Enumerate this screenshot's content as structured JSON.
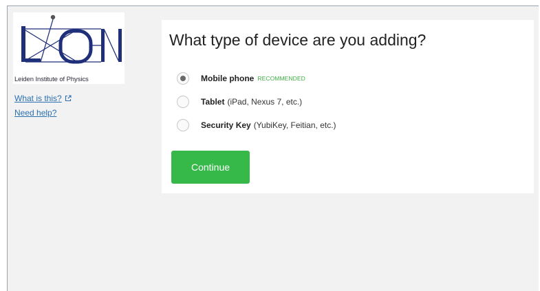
{
  "sidebar": {
    "logo_caption": "Leiden Institute of Physics",
    "logo_icon": "lion-logo-icon",
    "links": {
      "what_is_this": "What is this?",
      "need_help": "Need help?"
    },
    "external_link_icon": "external-link-icon"
  },
  "panel": {
    "title": "What type of device are you adding?",
    "options": [
      {
        "name": "Mobile phone",
        "detail": "",
        "badge": "RECOMMENDED",
        "selected": true
      },
      {
        "name": "Tablet",
        "detail": "(iPad, Nexus 7, etc.)",
        "badge": "",
        "selected": false
      },
      {
        "name": "Security Key",
        "detail": "(YubiKey, Feitian, etc.)",
        "badge": "",
        "selected": false
      }
    ],
    "continue_label": "Continue"
  },
  "colors": {
    "accent_green": "#37b94a",
    "badge_green": "#3cb043",
    "link_blue": "#2a6fb0",
    "logo_navy": "#1f2f7a",
    "background_gray": "#f2f2f2"
  }
}
